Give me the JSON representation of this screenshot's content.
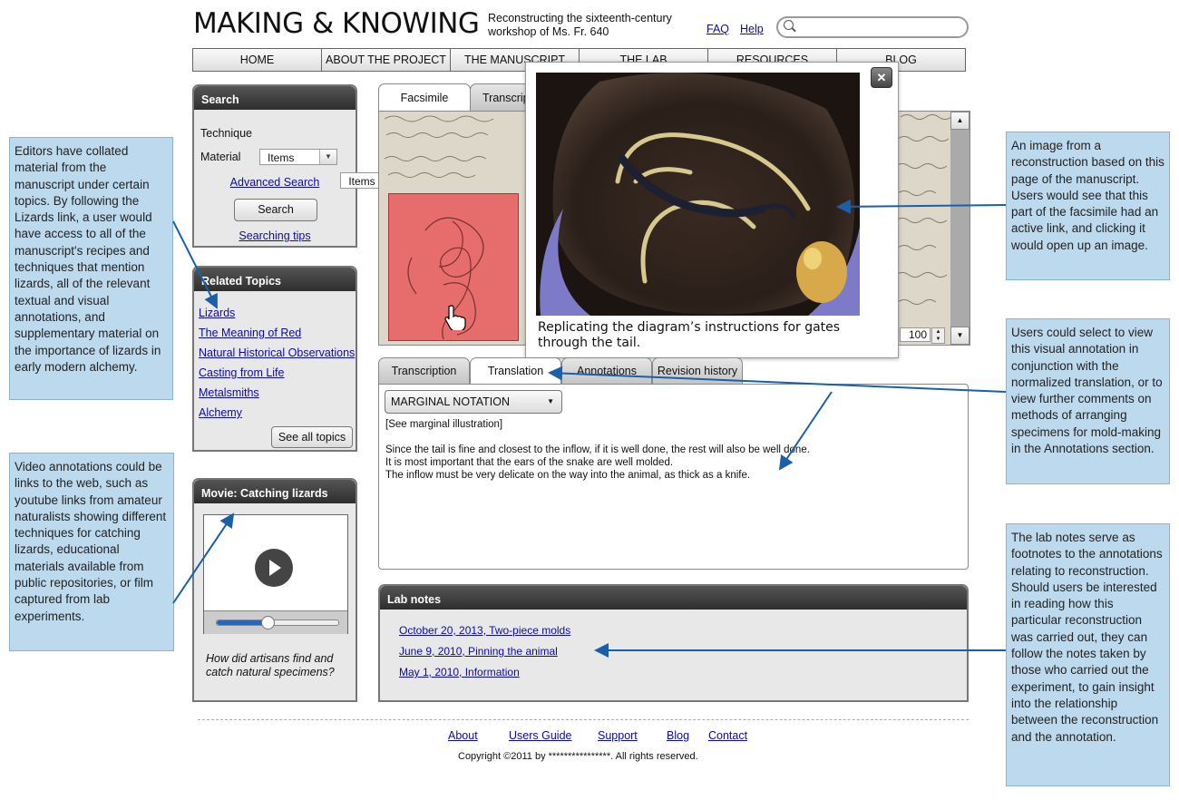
{
  "header": {
    "site_title": "MAKING & KNOWING",
    "tagline": "Reconstructing the sixteenth-century workshop of Ms. Fr. 640",
    "faq": "FAQ",
    "help": "Help",
    "search_value": ""
  },
  "nav": [
    "HOME",
    "ABOUT THE PROJECT",
    "THE MANUSCRIPT",
    "THE LAB",
    "RESOURCES",
    "BLOG"
  ],
  "search_panel": {
    "title": "Search",
    "technique_label": "Technique",
    "technique_value": "Items",
    "material_label": "Material",
    "material_value": "Items",
    "advanced": "Advanced Search",
    "button": "Search",
    "tips": "Searching tips"
  },
  "topics_panel": {
    "title": "Related Topics",
    "items": [
      "Lizards",
      "The Meaning of Red",
      "Natural Historical Observations",
      "Casting from Life",
      "Metalsmiths",
      "Alchemy"
    ],
    "see_all": "See all topics"
  },
  "movie_panel": {
    "title": "Movie: Catching lizards",
    "caption": "How did artisans find and catch natural specimens?",
    "progress": 0.42
  },
  "viewer": {
    "tabs": [
      "Facsimile",
      "Transcription"
    ],
    "zoom": "100"
  },
  "popup": {
    "close": "✕",
    "caption": "Replicating the diagram’s instructions for gates through the tail."
  },
  "text_panel": {
    "tabs": [
      "Transcription",
      "Translation",
      "Annotations",
      "Revision history"
    ],
    "active_tab": "Translation",
    "dropdown": "MARGINAL NOTATION",
    "lines": [
      "[See marginal illustration]",
      "",
      "Since the tail is fine and closest to the inflow, if it is well done, the rest will also be well done.",
      "It is most important that the ears of the snake are well molded.",
      "The inflow must be very delicate on the way into the animal, as thick as a knife."
    ]
  },
  "lab_notes": {
    "title": "Lab notes",
    "items": [
      "October 20, 2013, Two-piece molds",
      "June 9, 2010,  Pinning the animal",
      "May 1, 2010,  Information"
    ]
  },
  "footer": {
    "links": [
      "About",
      "Users Guide",
      "Support",
      "Blog",
      "Contact"
    ],
    "copyright": "Copyright ©2011 by ****************. All rights reserved."
  },
  "notes": {
    "left_top": "Editors have collated material from the manuscript under certain topics. By following the Lizards link, a user would have access to all of the manuscript's recipes and techniques that mention lizards, all of the relevant textual and visual annotations, and supplementary material on the importance of lizards in early modern alchemy.",
    "left_bottom": "Video annotations could be links to the web, such as youtube links from amateur naturalists showing different techniques for catching lizards, educational materials available from public repositories, or film captured from lab experiments.",
    "right_1": "An image from a reconstruction based on this page of the manuscript. Users would see that this part of the facsimile had an active link, and clicking it would open up an image.",
    "right_2": "Users could select to view this visual annotation in conjunction with the normalized translation, or to view further comments on methods of arranging specimens for mold-making in the Annotations section.",
    "right_3": "The lab notes serve as footnotes to the annotations relating to reconstruction. Should users be interested in reading how this particular reconstruction was carried out, they can follow the notes taken by those who carried out the experiment, to gain insight into the relationship between the reconstruction and the annotation."
  },
  "colors": {
    "note_bg": "#bdd9ee",
    "arrow": "#1a5fa8",
    "panel_header": "#3a3a3a",
    "link": "#0a0ab0"
  }
}
